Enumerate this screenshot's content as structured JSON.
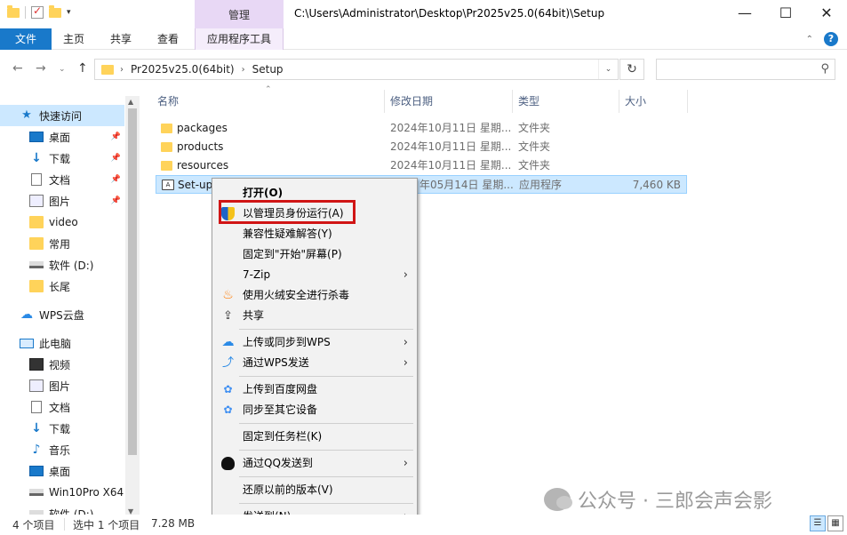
{
  "window": {
    "ctx_tab_head": "管理",
    "title": "C:\\Users\\Administrator\\Desktop\\Pr2025v25.0(64bit)\\Setup",
    "minimize": "—",
    "maximize": "☐",
    "close": "✕"
  },
  "ribbon": {
    "file": "文件",
    "home": "主页",
    "share": "共享",
    "view": "查看",
    "app_tools": "应用程序工具",
    "help": "?"
  },
  "address": {
    "crumbs": [
      "Pr2025v25.0(64bit)",
      "Setup"
    ],
    "search_placeholder": ""
  },
  "nav": {
    "items": [
      {
        "label": "快速访问",
        "icon": "star-icon"
      },
      {
        "label": "桌面",
        "icon": "desktop-icon",
        "pinned": true
      },
      {
        "label": "下载",
        "icon": "download-icon",
        "pinned": true
      },
      {
        "label": "文档",
        "icon": "document-icon",
        "pinned": true
      },
      {
        "label": "图片",
        "icon": "picture-icon",
        "pinned": true
      },
      {
        "label": "video",
        "icon": "folder-icon"
      },
      {
        "label": "常用",
        "icon": "folder-icon"
      },
      {
        "label": "软件 (D:)",
        "icon": "drive-icon"
      },
      {
        "label": "长尾",
        "icon": "folder-icon"
      },
      {
        "label": "WPS云盘",
        "icon": "cloud-icon"
      },
      {
        "label": "此电脑",
        "icon": "pc-icon"
      },
      {
        "label": "视频",
        "icon": "video-icon"
      },
      {
        "label": "图片",
        "icon": "picture-icon"
      },
      {
        "label": "文档",
        "icon": "document-icon"
      },
      {
        "label": "下载",
        "icon": "download-icon"
      },
      {
        "label": "音乐",
        "icon": "music-icon"
      },
      {
        "label": "桌面",
        "icon": "desktop-icon"
      },
      {
        "label": "Win10Pro X64",
        "icon": "drive-icon"
      },
      {
        "label": "软件 (D:)",
        "icon": "drive-icon"
      }
    ]
  },
  "columns": {
    "name": "名称",
    "date": "修改日期",
    "type": "类型",
    "size": "大小"
  },
  "files": [
    {
      "name": "packages",
      "date": "2024年10月11日 星期...",
      "type": "文件夹",
      "size": ""
    },
    {
      "name": "products",
      "date": "2024年10月11日 星期...",
      "type": "文件夹",
      "size": ""
    },
    {
      "name": "resources",
      "date": "2024年10月11日 星期...",
      "type": "文件夹",
      "size": ""
    },
    {
      "name": "Set-up",
      "date": "年05月14日 星期...",
      "type": "应用程序",
      "size": "7,460 KB"
    }
  ],
  "context_menu": {
    "open": "打开(O)",
    "run_as_admin": "以管理员身份运行(A)",
    "troubleshoot": "兼容性疑难解答(Y)",
    "pin_start": "固定到\"开始\"屏幕(P)",
    "zip": "7-Zip",
    "huorong": "使用火绒安全进行杀毒",
    "share": "共享",
    "wps_upload": "上传或同步到WPS",
    "wps_send": "通过WPS发送",
    "baidu_upload": "上传到百度网盘",
    "sync_device": "同步至其它设备",
    "pin_taskbar": "固定到任务栏(K)",
    "qq_send": "通过QQ发送到",
    "restore": "还原以前的版本(V)",
    "send_to": "发送到(N)"
  },
  "status": {
    "count": "4 个项目",
    "selected": "选中 1 个项目",
    "size": "7.28 MB"
  },
  "watermark": "公众号 · 三郎会声会影"
}
